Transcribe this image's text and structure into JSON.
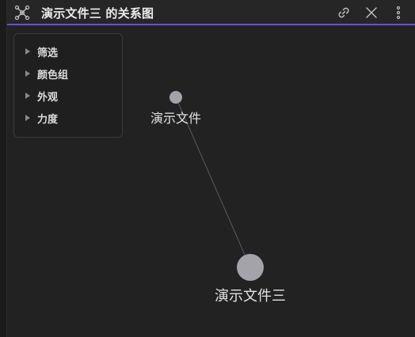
{
  "header": {
    "title": "演示文件三 的关系图",
    "icon": "graph-view-icon",
    "buttons": {
      "link": "link-icon",
      "close": "close-icon",
      "more": "more-vertical-icon"
    }
  },
  "panel": {
    "items": [
      {
        "label": "筛选"
      },
      {
        "label": "颜色组"
      },
      {
        "label": "外观"
      },
      {
        "label": "力度"
      }
    ]
  },
  "graph": {
    "nodes": [
      {
        "label": "演示文件"
      },
      {
        "label": "演示文件三"
      }
    ]
  },
  "colors": {
    "accent": "#6a4fd6",
    "background": "#222222",
    "node": "#a4a2aa",
    "edge": "#5a5a5a"
  }
}
